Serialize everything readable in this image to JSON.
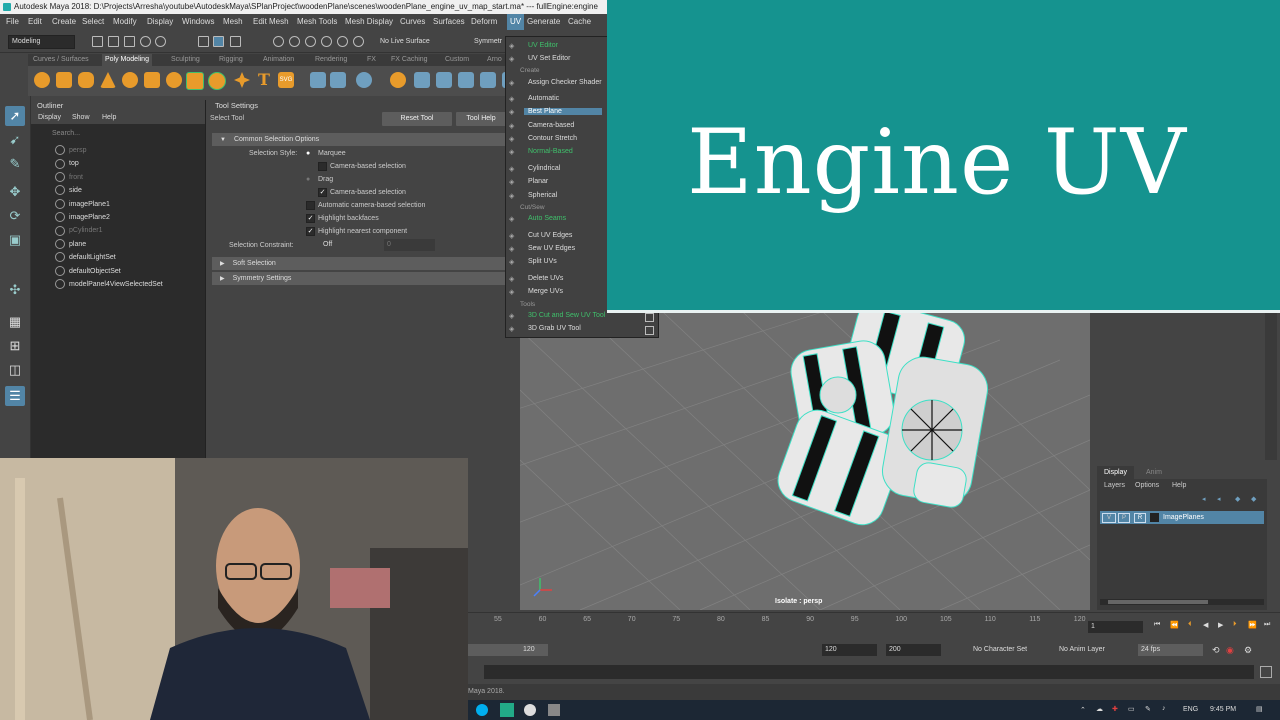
{
  "title_bar": {
    "text": "Autodesk Maya 2018: D:\\Projects\\Arresha\\youtube\\AutodeskMaya\\SPlanProject\\woodenPlane\\scenes\\woodenPlane_engine_uv_map_start.ma*  ---  fullEngine:engine",
    "minimize": "—",
    "maximize": "☐",
    "close": "✕"
  },
  "menu_bar": {
    "items": [
      "File",
      "Edit",
      "Create",
      "Select",
      "Modify",
      "Display",
      "Windows",
      "Mesh",
      "Edit Mesh",
      "Mesh Tools",
      "Mesh Display",
      "Curves",
      "Surfaces",
      "Deform",
      "UV",
      "Generate",
      "Cache"
    ]
  },
  "status_line": {
    "mode": "Modeling",
    "live_surface": "No Live Surface",
    "symmetry": "Symmetr"
  },
  "shelf": {
    "tabs": [
      "Curves / Surfaces",
      "Poly Modeling",
      "Sculpting",
      "Rigging",
      "Animation",
      "Rendering",
      "FX",
      "FX Caching",
      "Custom",
      "Arno"
    ],
    "active_tab": "Poly Modeling",
    "svg_label": "SVG"
  },
  "outliner": {
    "title": "Outliner",
    "menus": [
      "Display",
      "Show",
      "Help"
    ],
    "search_placeholder": "Search...",
    "items": [
      {
        "label": "persp",
        "dim": true
      },
      {
        "label": "top",
        "dim": false
      },
      {
        "label": "front",
        "dim": true
      },
      {
        "label": "side",
        "dim": false
      },
      {
        "label": "imagePlane1",
        "dim": false
      },
      {
        "label": "imagePlane2",
        "dim": false
      },
      {
        "label": "pCylinder1",
        "dim": true
      },
      {
        "label": "plane",
        "dim": false
      },
      {
        "label": "defaultLightSet",
        "dim": false
      },
      {
        "label": "defaultObjectSet",
        "dim": false
      },
      {
        "label": "modelPanel4ViewSelectedSet",
        "dim": false
      }
    ]
  },
  "tool_settings": {
    "title": "Tool Settings",
    "tool_name": "Select Tool",
    "reset_button": "Reset Tool",
    "help_button": "Tool Help",
    "common_section": "Common Selection Options",
    "selection_style_label": "Selection Style:",
    "marquee": "Marquee",
    "camera_based_selection": "Camera-based selection",
    "drag": "Drag",
    "camera_based_selection_2": "Camera-based selection",
    "auto_camera_selection": "Automatic camera-based selection",
    "highlight_backfaces": "Highlight backfaces",
    "highlight_nearest": "Highlight nearest component",
    "constraint_label": "Selection Constraint:",
    "constraint_value": "Off",
    "constraint_number": "0",
    "soft_selection": "Soft Selection",
    "symmetry_settings": "Symmetry Settings"
  },
  "uv_menu": {
    "items": [
      {
        "label": "UV Editor",
        "kind": "green",
        "opt": false
      },
      {
        "label": "UV Set Editor",
        "kind": "normal",
        "opt": false
      },
      {
        "label": "Create",
        "kind": "header",
        "opt": false
      },
      {
        "label": "Assign Checker Shader",
        "kind": "normal",
        "opt": false
      },
      {
        "label": "Automatic",
        "kind": "normal",
        "opt": true
      },
      {
        "label": "Best Plane",
        "kind": "highlight",
        "opt": true
      },
      {
        "label": "Camera-based",
        "kind": "normal",
        "opt": true
      },
      {
        "label": "Contour Stretch",
        "kind": "normal",
        "opt": true
      },
      {
        "label": "Normal-Based",
        "kind": "green",
        "opt": true
      },
      {
        "label": "Cylindrical",
        "kind": "normal",
        "opt": true
      },
      {
        "label": "Planar",
        "kind": "normal",
        "opt": true
      },
      {
        "label": "Spherical",
        "kind": "normal",
        "opt": true
      },
      {
        "label": "Cut/Sew",
        "kind": "header",
        "opt": false
      },
      {
        "label": "Auto Seams",
        "kind": "green",
        "opt": true
      },
      {
        "label": "Cut UV Edges",
        "kind": "normal",
        "opt": true
      },
      {
        "label": "Sew UV Edges",
        "kind": "normal",
        "opt": true
      },
      {
        "label": "Split UVs",
        "kind": "normal",
        "opt": true
      },
      {
        "label": "Delete UVs",
        "kind": "normal",
        "opt": true
      },
      {
        "label": "Merge UVs",
        "kind": "normal",
        "opt": true
      },
      {
        "label": "Tools",
        "kind": "header",
        "opt": false
      },
      {
        "label": "3D Cut and Sew UV Tool",
        "kind": "green",
        "opt": true
      },
      {
        "label": "3D Grab UV Tool",
        "kind": "normal",
        "opt": true
      }
    ]
  },
  "banner": {
    "title": "Engine UV"
  },
  "viewport": {
    "camera_label": "Isolate : persp"
  },
  "layer_editor": {
    "tabs": [
      "Display",
      "Anim"
    ],
    "menus": [
      "Layers",
      "Options",
      "Help"
    ],
    "layer_v": "V",
    "layer_p": "P",
    "layer_r": "R",
    "layer_name": "ImagePlanes"
  },
  "timeline": {
    "ticks": [
      "55",
      "60",
      "65",
      "70",
      "75",
      "80",
      "85",
      "90",
      "95",
      "100",
      "105",
      "110",
      "115",
      "120"
    ],
    "current_frame": "1"
  },
  "range_slider": {
    "end_inner": "120",
    "end_outer": "120",
    "max": "200",
    "character_set": "No Character Set",
    "anim_layer": "No Anim Layer",
    "fps": "24 fps"
  },
  "help_line": {
    "text": "Maya 2018."
  },
  "taskbar": {
    "language": "ENG",
    "time": "9:45 PM"
  }
}
